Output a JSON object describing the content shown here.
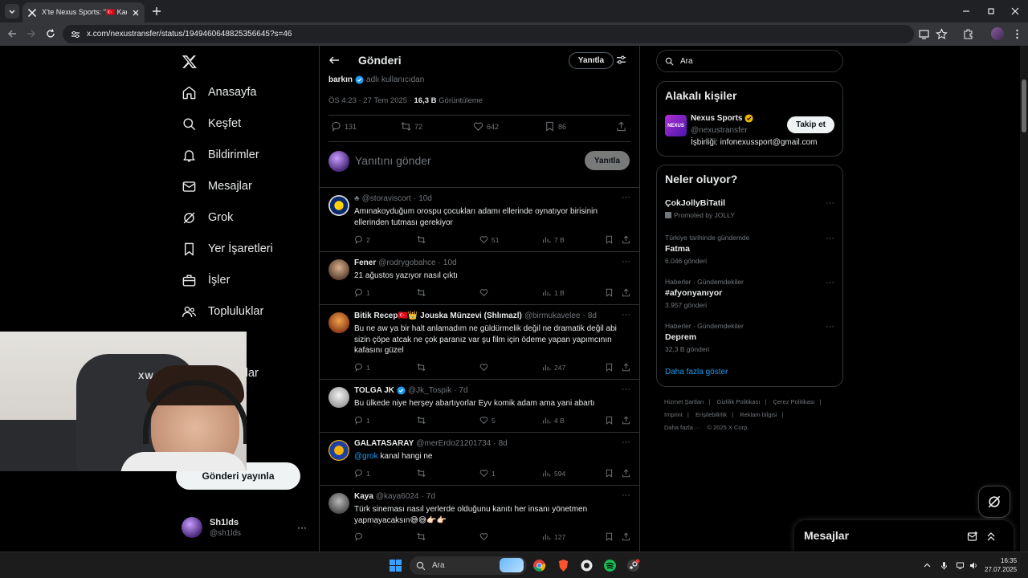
{
  "browser": {
    "tab_title": "X'te Nexus Sports: \"🇹🇷 Kadıköy",
    "url": "x.com/nexustransfer/status/1949460648825356645?s=46"
  },
  "colors": {
    "accent": "#1d9bf0",
    "background": "#000000",
    "border": "#2f3336",
    "muted": "#71767b",
    "text": "#e7e9ea"
  },
  "nav": {
    "items": [
      {
        "label": "Anasayfa",
        "icon": "home-icon"
      },
      {
        "label": "Keşfet",
        "icon": "search-icon"
      },
      {
        "label": "Bildirimler",
        "icon": "bell-icon"
      },
      {
        "label": "Mesajlar",
        "icon": "mail-icon"
      },
      {
        "label": "Grok",
        "icon": "grok-icon"
      },
      {
        "label": "Yer İşaretleri",
        "icon": "bookmark-icon"
      },
      {
        "label": "İşler",
        "icon": "briefcase-icon"
      },
      {
        "label": "Topluluklar",
        "icon": "people-icon"
      },
      {
        "label": "n",
        "icon": ""
      },
      {
        "label": "kuruluşlar",
        "icon": ""
      },
      {
        "label": "zla",
        "icon": ""
      }
    ],
    "post_button": "Gönderi yayınla",
    "account": {
      "name": "Sh1lds",
      "handle": "@sh1lds",
      "more": "···"
    }
  },
  "center": {
    "header_title": "Gönderi",
    "header_reply_button": "Yanıtla",
    "tweet": {
      "author": "barkın",
      "author_suffix": "adlı kullanıcıdan",
      "time": "ÖS 4:23 · 27 Tem 2025 ·",
      "views_count": "16,3 B",
      "views_label": "Görüntüleme",
      "stats": {
        "replies": "131",
        "retweets": "72",
        "likes": "642",
        "bookmarks": "86"
      }
    },
    "composer": {
      "placeholder": "Yanıtını gönder",
      "button": "Yanıtla"
    },
    "replies": [
      {
        "name": "",
        "handle": "@storaviscort",
        "time": "10d",
        "text": "Amınakoyduğum orospu çocukları adamı ellerinde oynatıyor birisinin ellerinden tutması gerekiyor",
        "replies": "2",
        "retweets": "",
        "likes": "51",
        "views": "7 B"
      },
      {
        "name": "Fener",
        "handle": "@rodrygobahce",
        "time": "10d",
        "text": "21 ağustos yazıyor nasıl çıktı",
        "replies": "1",
        "retweets": "",
        "likes": "",
        "views": "1 B"
      },
      {
        "name": "Bitik Recep🇹🇷👑 Jouska Münzevi (Shlımazl)",
        "handle": "@birmukaveleе",
        "time": "8d",
        "text": "Bu ne aw ya bir halt anlamadım ne güldürmelik değil ne dramatik değil abi sizin çöpe atcak ne çok paranız var şu film için ödeme yapan yapımcının kafasını güzel",
        "replies": "1",
        "retweets": "",
        "likes": "",
        "views": "247"
      },
      {
        "name": "TOLGA JK",
        "handle": "@Jk_Tospik",
        "time": "7d",
        "text": "Bu ülkede niye herşey abartıyorlar Eyv komik adam ama yani abartı",
        "replies": "1",
        "retweets": "",
        "likes": "5",
        "views": "4 B"
      },
      {
        "name": "GALATASARAY",
        "handle": "@merErdo21201734",
        "time": "8d",
        "mention": "@grok",
        "text": " kanal hangi ne",
        "replies": "1",
        "retweets": "",
        "likes": "1",
        "views": "594"
      },
      {
        "name": "Kaya",
        "handle": "@kaya6024",
        "time": "7d",
        "text": "Türk sineması nasıl yerlerde olduğunu kanıtı her insanı yönetmen yapmayacaksın😅😅👉🏻👉🏻",
        "replies": "",
        "retweets": "",
        "likes": "",
        "views": "127"
      }
    ]
  },
  "right": {
    "search_placeholder": "Ara",
    "related_title": "Alakalı kişiler",
    "related_person": {
      "avatar_text": "NEXUS",
      "name": "Nexus Sports",
      "handle": "@nexustransfer",
      "bio": "İşbirliği: infonexussport@gmail.com",
      "follow": "Takip et"
    },
    "trends_title": "Neler oluyor?",
    "trends": [
      {
        "context": "",
        "name": "ÇokJollyBiTatil",
        "count": "Promoted by JOLLY",
        "promoted": true
      },
      {
        "context": "Türkiye tarihinde gündemde",
        "name": "Fatma",
        "count": "6.046 gönderi"
      },
      {
        "context": "Haberler · Gündemdekiler",
        "name": "#afyonyanıyor",
        "count": "3.957 gönderi"
      },
      {
        "context": "Haberler · Gündemdekiler",
        "name": "Deprem",
        "count": "32,3 B gönderi"
      }
    ],
    "show_more": "Daha fazla göster",
    "footer": [
      "Hizmet Şartları",
      "|",
      "Gizlilik Politikası",
      "|",
      "Çerez Politikası",
      "|",
      "Imprint",
      "|",
      "Erişilebilirlik",
      "|",
      "Reklam bilgisi",
      "|",
      "Daha fazla ···",
      "© 2025 X Corp."
    ],
    "messages_drawer": "Mesajlar"
  },
  "webcam": {
    "brand": "XWAH"
  },
  "taskbar": {
    "search": "Ara",
    "time": "16:35",
    "date": "27.07.2025"
  }
}
